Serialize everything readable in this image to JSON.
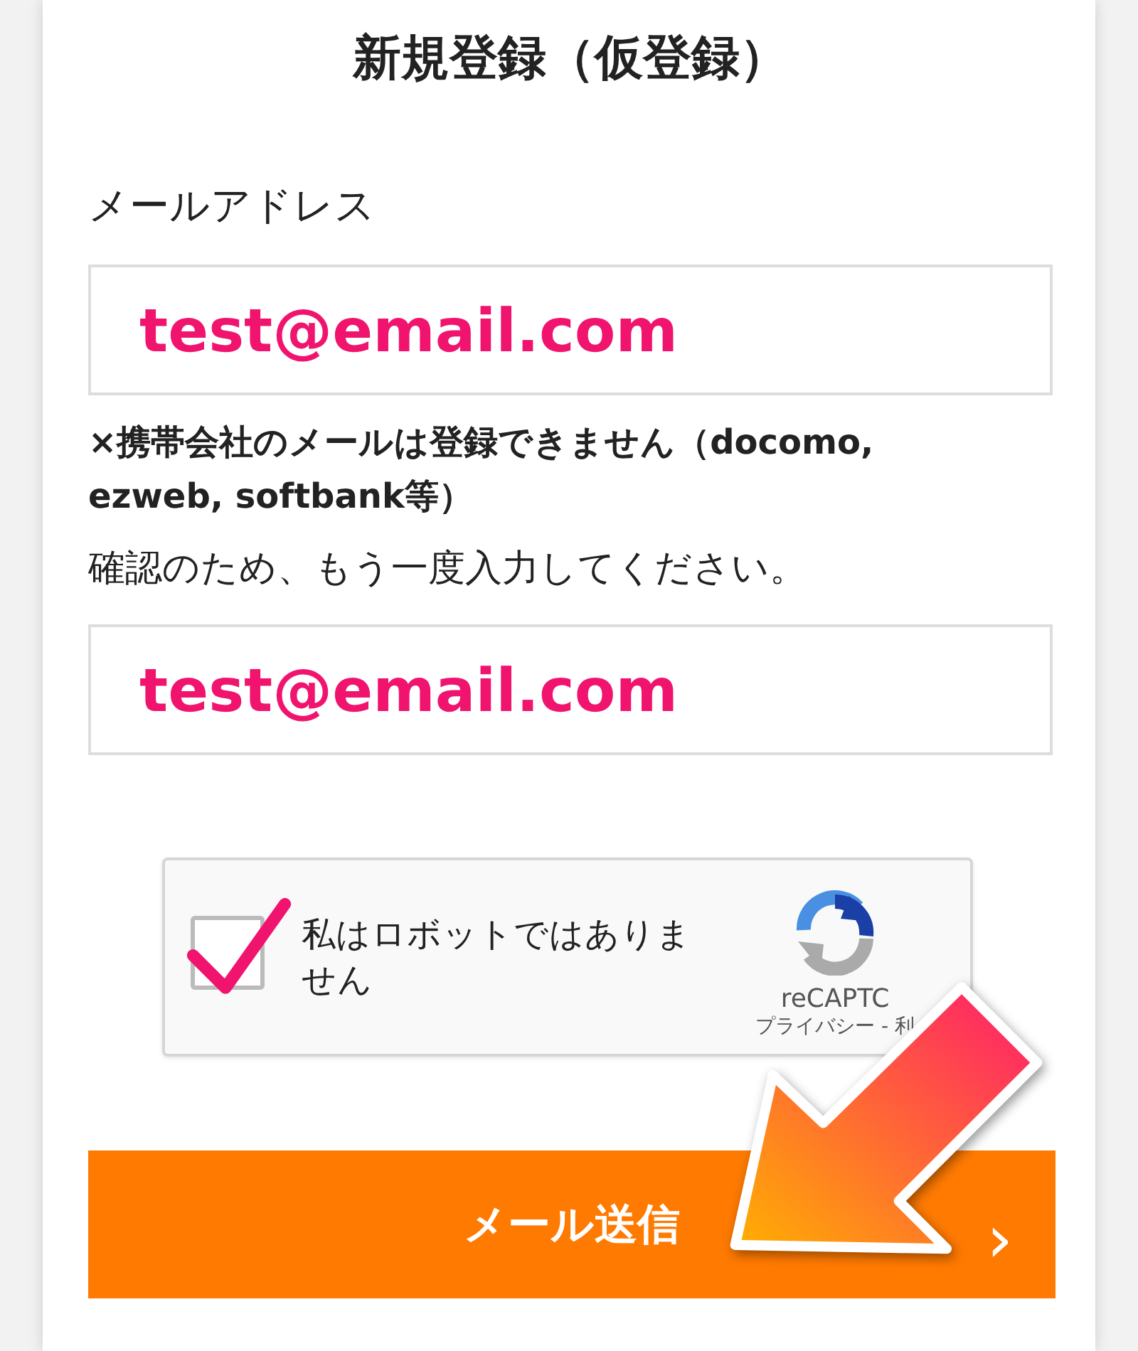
{
  "title": "新規登録（仮登録）",
  "email": {
    "label": "メールアドレス",
    "value": "test@email.com"
  },
  "note": "×携帯会社のメールは登録できません（docomo, ezweb, softbank等）",
  "confirm": {
    "label": "確認のため、もう一度入力してください。",
    "value": "test@email.com"
  },
  "captcha": {
    "label": "私はロボットではありません",
    "checked": true,
    "brand": "reCAPTC",
    "links": "プライバシー - 利"
  },
  "submit": {
    "label": "メール送信",
    "chevron": "›"
  }
}
